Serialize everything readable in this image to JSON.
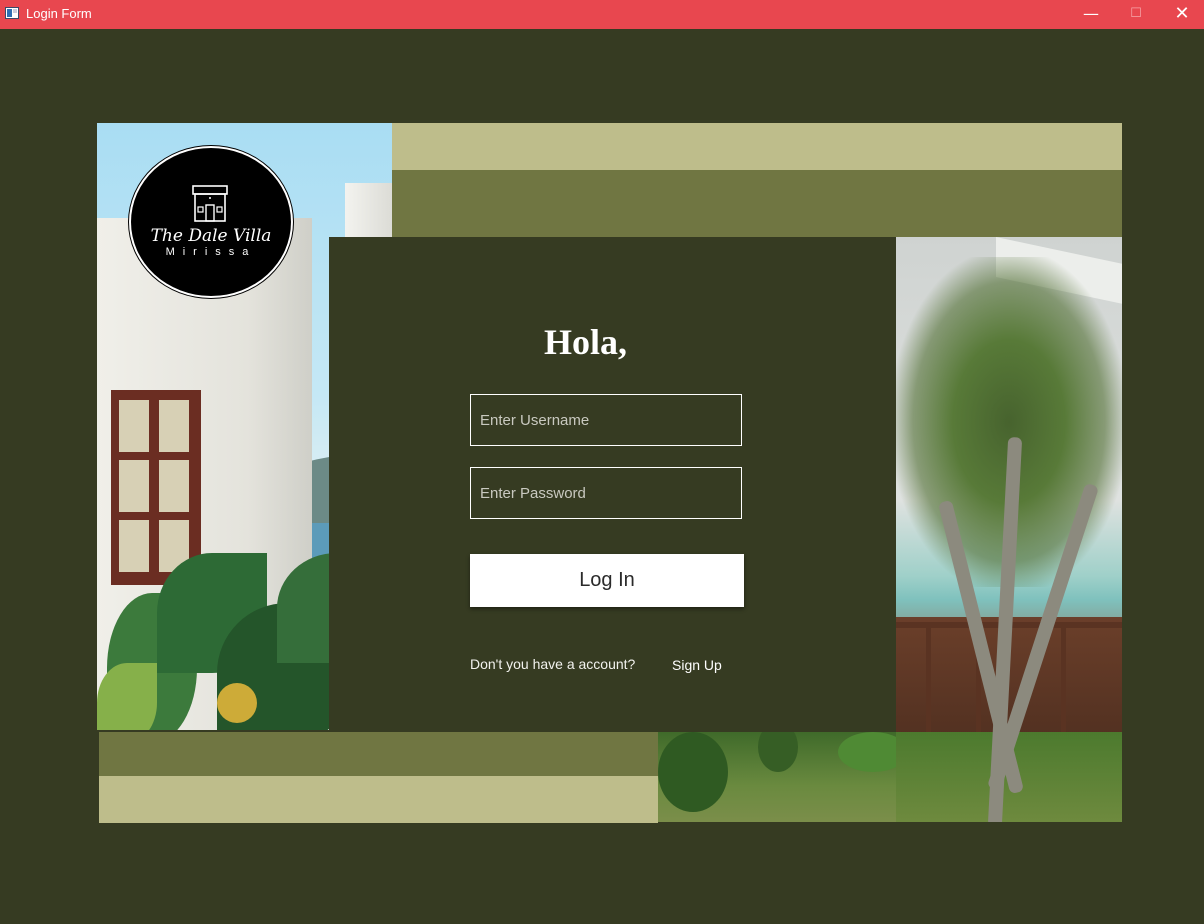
{
  "window": {
    "title": "Login Form",
    "minimize_glyph": "—",
    "maximize_glyph": "☐",
    "close_glyph": "✕",
    "titlebar_color": "#e8474f"
  },
  "brand": {
    "name": "The Dale Villa",
    "location": "Mirissa",
    "logo_icon": "house-icon"
  },
  "login": {
    "greeting": "Hola,",
    "username_placeholder": "Enter Username",
    "password_placeholder": "Enter Password",
    "login_label": "Log In",
    "no_account_text": "Don't you have a account?",
    "signup_label": "Sign Up"
  },
  "theme": {
    "background": "#363b22",
    "band_light": "#bebd8b",
    "band_dark": "#707642",
    "button_bg": "#ffffff"
  }
}
